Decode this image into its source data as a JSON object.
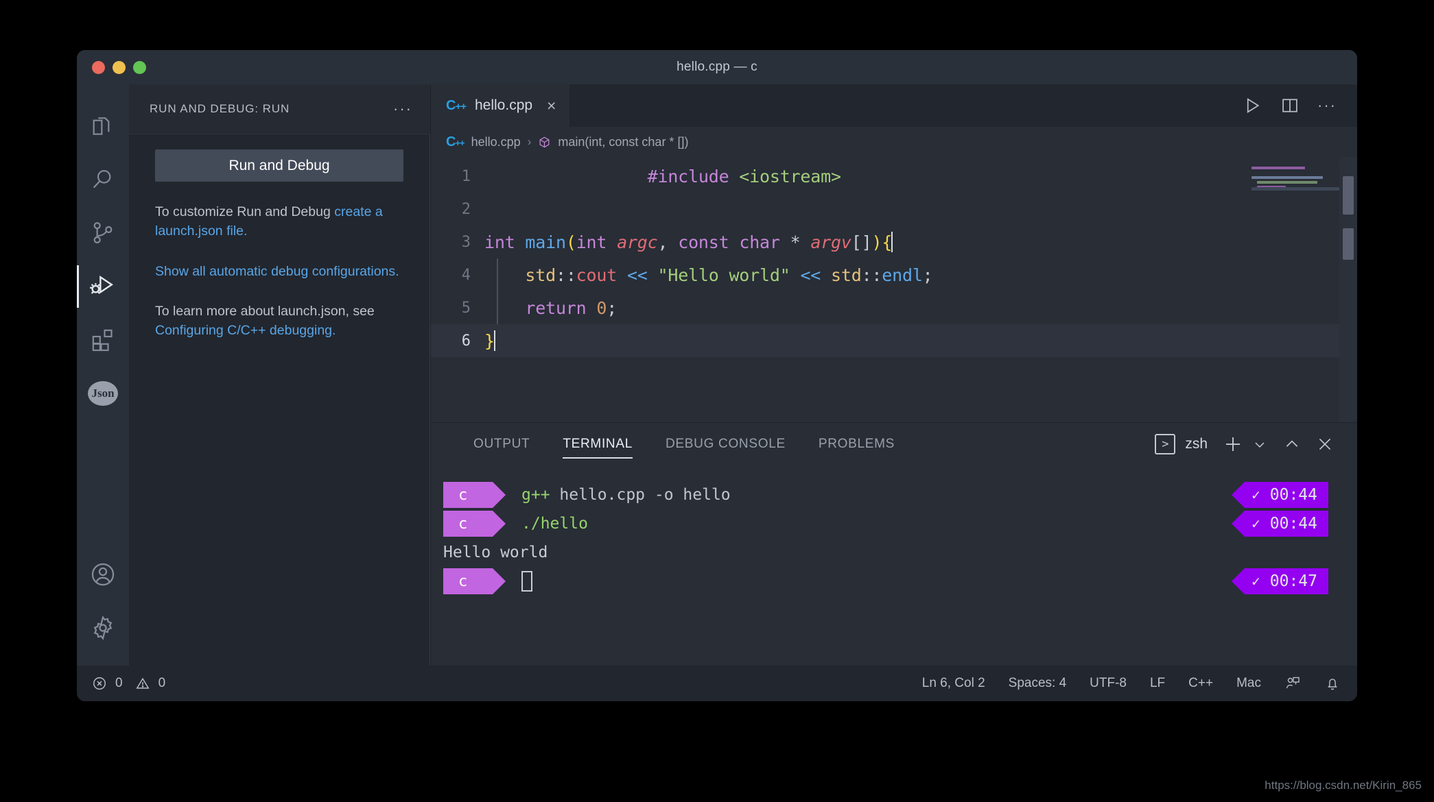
{
  "window": {
    "title": "hello.cpp — c",
    "traffic_lights": [
      "close",
      "minimize",
      "zoom"
    ]
  },
  "activitybar": {
    "items": [
      {
        "name": "explorer",
        "icon": "files-icon",
        "active": false
      },
      {
        "name": "search",
        "icon": "search-icon",
        "active": false
      },
      {
        "name": "source-control",
        "icon": "source-control-icon",
        "active": false
      },
      {
        "name": "run-and-debug",
        "icon": "run-debug-icon",
        "active": true
      },
      {
        "name": "extensions",
        "icon": "extensions-icon",
        "active": false
      },
      {
        "name": "json-viewer",
        "icon": "json-icon",
        "label": "Json",
        "active": false
      }
    ],
    "bottom_items": [
      {
        "name": "accounts",
        "icon": "account-icon"
      },
      {
        "name": "settings",
        "icon": "gear-icon"
      }
    ]
  },
  "sidebar": {
    "title": "RUN AND DEBUG: RUN",
    "more_actions": "···",
    "run_button": "Run and Debug",
    "paragraphs": [
      {
        "lead": "To customize Run and Debug ",
        "link": "create a launch.json file.",
        "tail": ""
      },
      {
        "lead": "",
        "link": "Show all automatic debug configurations.",
        "tail": ""
      },
      {
        "lead": "To learn more about launch.json, see ",
        "link": "Configuring C/C++ debugging.",
        "tail": ""
      }
    ]
  },
  "editor": {
    "tab": {
      "label": "hello.cpp",
      "icon": "cpp-icon",
      "close": "×"
    },
    "tab_actions": [
      {
        "name": "run-file-button",
        "icon": "play-icon"
      },
      {
        "name": "split-editor-button",
        "icon": "split-editor-icon"
      },
      {
        "name": "more-actions-button",
        "icon": "ellipsis-icon"
      }
    ],
    "breadcrumb": {
      "file_icon": "cpp-icon",
      "file": "hello.cpp",
      "separator": "›",
      "symbol_icon": "symbol-method-icon",
      "symbol": "main(int, const char * [])"
    },
    "lines": [
      {
        "no": "1",
        "current": false
      },
      {
        "no": "2",
        "current": false
      },
      {
        "no": "3",
        "current": false
      },
      {
        "no": "4",
        "current": false
      },
      {
        "no": "5",
        "current": false
      },
      {
        "no": "6",
        "current": true
      }
    ],
    "code": {
      "l1_include": "#include",
      "l1_header": "<iostream>",
      "l3_int": "int",
      "l3_main": "main",
      "l3_paren_open": "(",
      "l3_int2": "int",
      "l3_argc": "argc",
      "l3_comma": ",",
      "l3_const": "const",
      "l3_char": "char",
      "l3_star": "*",
      "l3_argv": "argv",
      "l3_brackets": "[]",
      "l3_paren_close": ")",
      "l3_brace": "{",
      "l4_std": "std",
      "l4_colons": "::",
      "l4_cout": "cout",
      "l4_shift": "<<",
      "l4_string": "\"Hello world\"",
      "l4_shift2": "<<",
      "l4_std2": "std",
      "l4_colons2": "::",
      "l4_endl": "endl",
      "l4_semi": ";",
      "l5_return": "return",
      "l5_zero": "0",
      "l5_semi": ";",
      "l6_brace": "}"
    }
  },
  "panel": {
    "tabs": [
      {
        "label": "OUTPUT",
        "active": false
      },
      {
        "label": "TERMINAL",
        "active": true
      },
      {
        "label": "DEBUG CONSOLE",
        "active": false
      },
      {
        "label": "PROBLEMS",
        "active": false
      }
    ],
    "shell_icon": ">",
    "shell_name": "zsh",
    "actions": [
      {
        "name": "new-terminal-button",
        "icon": "plus-icon"
      },
      {
        "name": "terminal-dropdown-button",
        "icon": "chevron-down-icon"
      },
      {
        "name": "maximize-panel-button",
        "icon": "chevron-up-icon"
      },
      {
        "name": "close-panel-button",
        "icon": "close-icon"
      }
    ],
    "terminal": {
      "lines": [
        {
          "type": "prompt",
          "segment": "c",
          "command": "g++ hello.cpp -o hello",
          "cmd_head": "g++",
          "cmd_rest": " hello.cpp -o hello",
          "badge": {
            "check": "✓",
            "time": "00:44"
          }
        },
        {
          "type": "prompt",
          "segment": "c",
          "command": "./hello",
          "cmd_head": "./hello",
          "cmd_rest": "",
          "badge": {
            "check": "✓",
            "time": "00:44"
          }
        },
        {
          "type": "output",
          "text": "Hello world"
        },
        {
          "type": "prompt-cursor",
          "segment": "c",
          "badge": {
            "check": "✓",
            "time": "00:47"
          }
        }
      ]
    }
  },
  "statusbar": {
    "errors_icon": "error-circle-icon",
    "errors": "0",
    "warnings_icon": "warning-triangle-icon",
    "warnings": "0",
    "position": "Ln 6, Col 2",
    "indentation": "Spaces: 4",
    "encoding": "UTF-8",
    "eol": "LF",
    "language": "C++",
    "platform": "Mac",
    "live_share_icon": "live-share-icon",
    "bell_icon": "bell-icon"
  },
  "watermark": "https://blog.csdn.net/Kirin_865",
  "colors": {
    "accent_purple": "#c265e0",
    "badge_purple": "#9400f0",
    "link_blue": "#58a6e8",
    "cpp_blue": "#2a9fe0",
    "terminal_green": "#96d46a"
  }
}
